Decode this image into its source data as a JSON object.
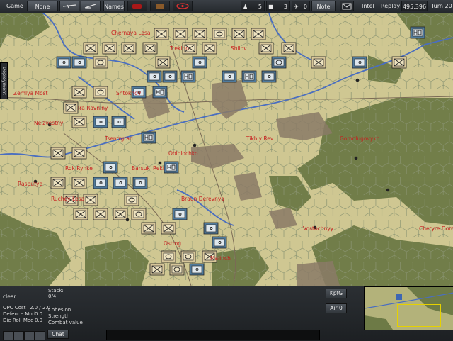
{
  "toolbar": {
    "game_label": "Game",
    "none_label": "None",
    "names_label": "Names",
    "count1": "5",
    "count2": "3",
    "count3": "0",
    "note_label": "Note",
    "intel_label": "Intel",
    "replay_label": "Replay",
    "score": "495,396",
    "turn_label": "Turn 20"
  },
  "side_tab_label": "Deployment",
  "map": {
    "colors": {
      "plains": "#cfc792",
      "forest": "#6d7a46",
      "river": "#4a6ec0",
      "hex_line": "#7f8d6a",
      "label": "#c81e1e"
    },
    "towns": [
      "Chernaya Lesa",
      "Trekino",
      "Shilov",
      "Zemlya Most",
      "Shtokhov",
      "Ira Ravniny",
      "Neizvestny",
      "Tsentrgrad",
      "Oblolochko",
      "Tikhiy Rev",
      "Gomolugovykh",
      "Rok Rynke",
      "Barsuk",
      "Reki",
      "Rasputye",
      "Ruchey Lesa",
      "Braun Derevnya",
      "Ostrog",
      "Vostochnyy",
      "Chetyre Doroga",
      "Malinch"
    ]
  },
  "panel": {
    "terrain": "clear",
    "stack_label": "Stack:",
    "stack_value": "0/4",
    "opc_label": "OPC Cost",
    "opc_value": "2.0 / 2.0",
    "defence_label": "Defence Mod",
    "defence_value": "0.0",
    "dieroll_label": "Die Roll Mod",
    "dieroll_value": "0.0",
    "cohesion_label": "Cohesion",
    "strength_label": "Strength",
    "combat_label": "Combat value",
    "kpfg_label": "KpfG",
    "air_label": "Air",
    "air_value": "0",
    "chat_label": "Chat"
  }
}
